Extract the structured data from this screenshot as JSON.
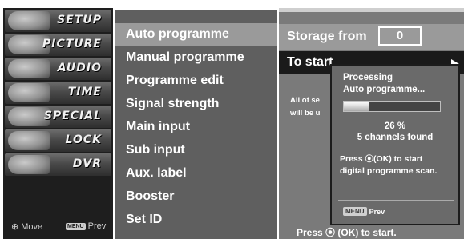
{
  "left_menu": {
    "items": [
      {
        "label": "SETUP",
        "icon": "satellite-dish-icon"
      },
      {
        "label": "PICTURE",
        "icon": "film-reel-icon"
      },
      {
        "label": "AUDIO",
        "icon": "speaker-icon"
      },
      {
        "label": "TIME",
        "icon": "clock-icon"
      },
      {
        "label": "SPECIAL",
        "icon": "special-badge-icon"
      },
      {
        "label": "LOCK",
        "icon": "lock-icon"
      },
      {
        "label": "DVR",
        "icon": "disc-icon"
      }
    ],
    "footer": {
      "move_label": "Move",
      "menu_key": "MENU",
      "prev_label": "Prev"
    }
  },
  "setup_menu": {
    "items": [
      "Auto programme",
      "Manual programme",
      "Programme edit",
      "Signal strength",
      "Main input",
      "Sub input",
      "Aux. label",
      "Booster",
      "Set ID"
    ],
    "selected": "Auto programme"
  },
  "auto_programme": {
    "storage_label": "Storage from",
    "storage_value": "0",
    "to_start_label": "To start",
    "description_fragments": [
      "All of se",
      "will be u"
    ],
    "press_ok_text": "Press ⦿ (OK) to start."
  },
  "processing_popup": {
    "title_line1": "Processing",
    "title_line2": "Auto programme...",
    "progress_percent": 26,
    "percent_text": "26 %",
    "found_text": "5 channels found",
    "ok_line1": "Press ⦿(OK) to start",
    "ok_line2": "digital programme scan.",
    "menu_key": "MENU",
    "prev_label": "Prev"
  }
}
